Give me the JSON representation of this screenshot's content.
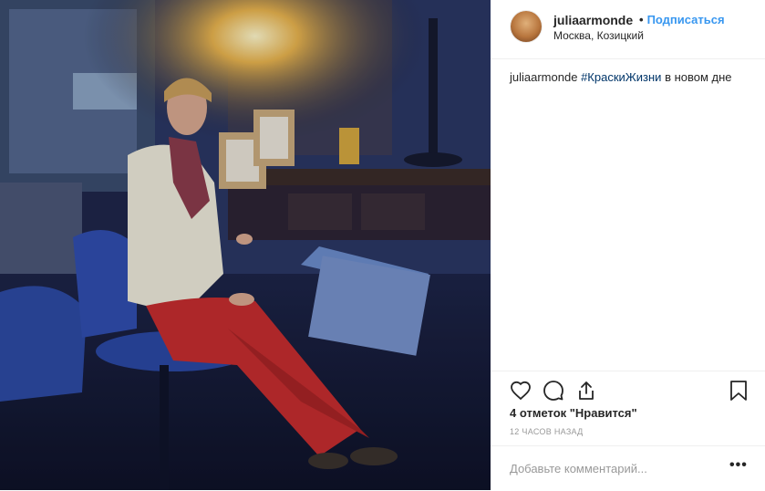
{
  "post": {
    "username": "juliaarmonde",
    "separator": "•",
    "follow_label": "Подписаться",
    "location": "Москва, Козицкий",
    "caption": {
      "username": "juliaarmonde",
      "hashtag": "#КраскиЖизни",
      "text": " в новом дне"
    },
    "likes_label": "4 отметок \"Нравится\"",
    "timestamp": "12 часов назад",
    "comment_placeholder": "Добавьте комментарий...",
    "more_label": "•••"
  },
  "icons": {
    "like": "heart-icon",
    "comment": "comment-icon",
    "share": "share-icon",
    "save": "bookmark-icon"
  },
  "colors": {
    "link": "#3897f0",
    "hashtag": "#003569",
    "muted": "#999999",
    "text": "#262626"
  }
}
